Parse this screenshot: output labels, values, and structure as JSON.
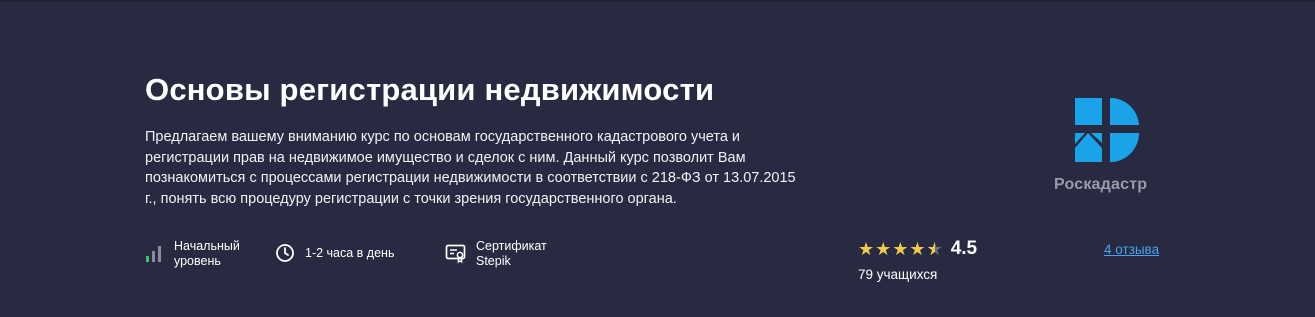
{
  "course": {
    "title": "Основы регистрации недвижимости",
    "description": "Предлагаем вашему вниманию курс по основам государственного кадастрового учета и регистрации прав на недвижимое имущество и сделок с ним. Данный курс позволит Вам познакомиться с процессами регистрации недвижимости в соответствии с 218-ФЗ от 13.07.2015 г., понять всю процедуру регистрации с точки зрения государственного органа."
  },
  "meta": {
    "level_line1": "Начальный",
    "level_line2": "уровень",
    "time": "1-2 часа в день",
    "cert_line1": "Сертификат",
    "cert_line2": "Stepik"
  },
  "rating": {
    "value": "4.5",
    "stars": 4.5,
    "students": "79 учащихся",
    "reviews_link": "4 отзыва",
    "star_color": "#f2c94c"
  },
  "author": {
    "name": "Роскадастр",
    "logo_color": "#1aa3e8"
  },
  "colors": {
    "background": "#282a41",
    "link": "#4aa3f0",
    "level_bars": "#3ec466"
  }
}
